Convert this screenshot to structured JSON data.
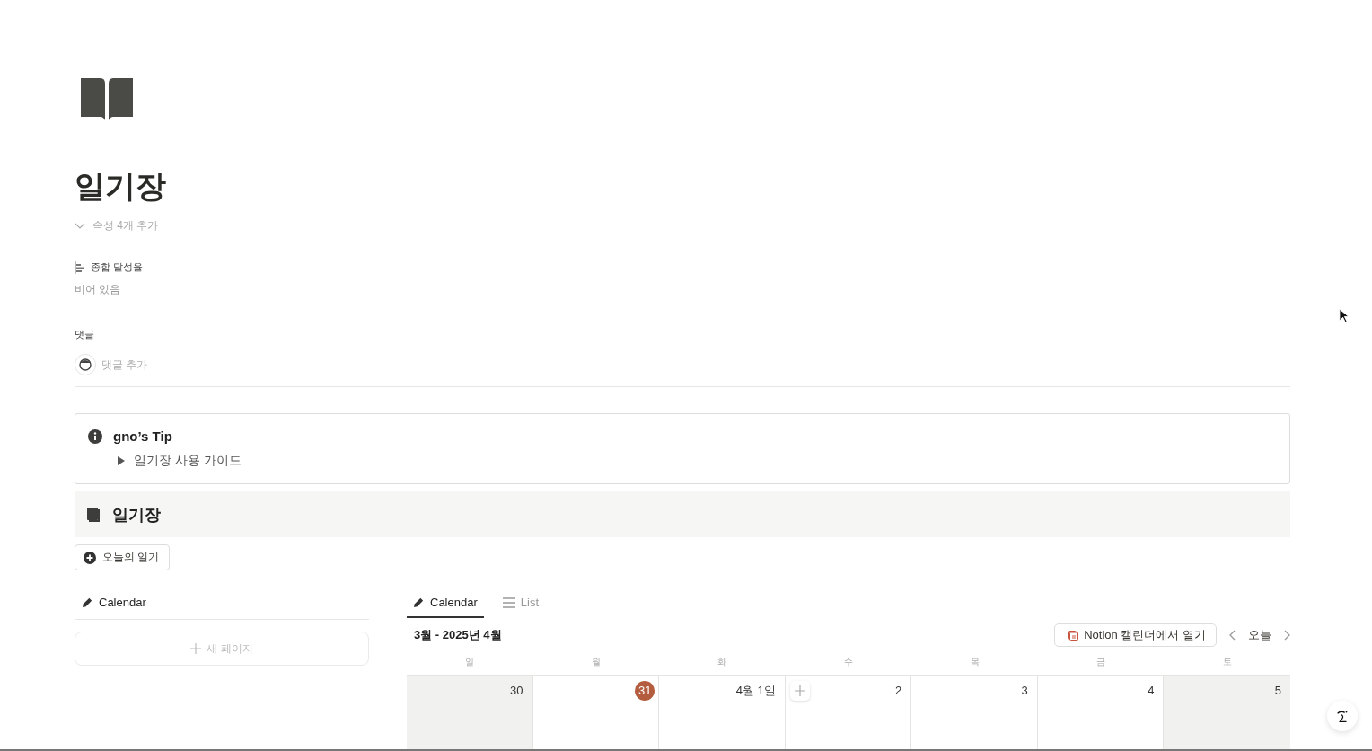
{
  "page": {
    "title": "일기장",
    "properties_toggle": "속성 4개 추가",
    "property": {
      "label": "종합 달성율",
      "value": "비어 있음"
    },
    "comments": {
      "label": "댓글",
      "placeholder": "댓글 추가"
    }
  },
  "callout": {
    "title": "gno’s Tip",
    "toggle": "일기장 사용 가이드"
  },
  "section": {
    "title": "일기장"
  },
  "new_entry_button": "오늘의 일기",
  "left_view": {
    "tab": "Calendar",
    "new_page": "새 페이지"
  },
  "calendar": {
    "tabs": [
      {
        "label": "Calendar",
        "kind": "calendar",
        "selected": true
      },
      {
        "label": "List",
        "kind": "list",
        "selected": false
      }
    ],
    "range": "3월 - 2025년 4월",
    "open_button": "Notion 캘린더에서 열기",
    "today_button": "오늘",
    "weekdays": [
      "일",
      "월",
      "화",
      "수",
      "목",
      "금",
      "토"
    ],
    "days": [
      {
        "label": "30",
        "weekend": true,
        "today": false,
        "hovered": false
      },
      {
        "label": "31",
        "weekend": false,
        "today": true,
        "hovered": false
      },
      {
        "label": "4월 1일",
        "weekend": false,
        "today": false,
        "hovered": false
      },
      {
        "label": "2",
        "weekend": false,
        "today": false,
        "hovered": true
      },
      {
        "label": "3",
        "weekend": false,
        "today": false,
        "hovered": false
      },
      {
        "label": "4",
        "weekend": false,
        "today": false,
        "hovered": false
      },
      {
        "label": "5",
        "weekend": true,
        "today": false,
        "hovered": false
      }
    ]
  }
}
